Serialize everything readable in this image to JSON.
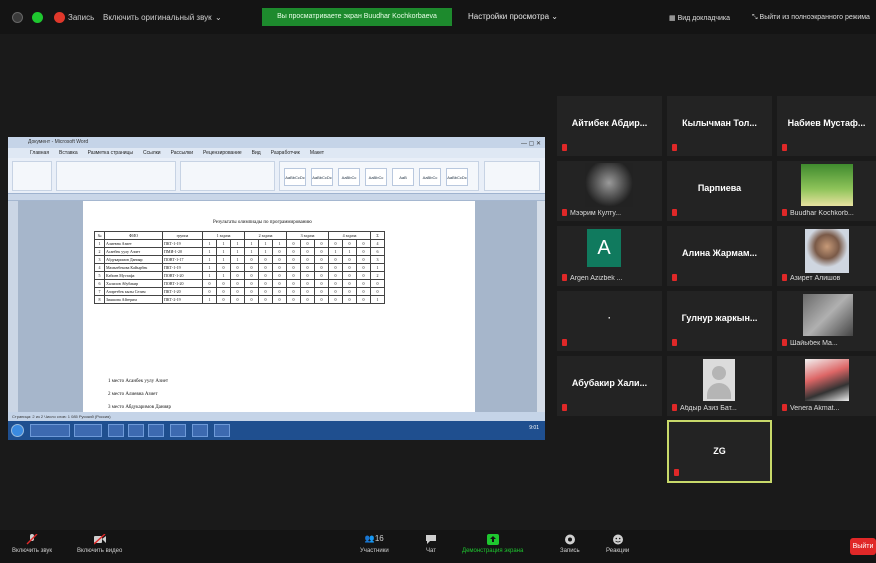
{
  "topbar": {
    "recording_label": "Запись",
    "original_sound": "Включить оригинальный звук",
    "share_banner": "Вы просматриваете экран Buudhar Kochkorbaeva",
    "view_options": "Настройки просмотра ⌄",
    "speaker_view": "Вид докладчика",
    "exit_fullscreen": "Выйти из полноэкранного режима"
  },
  "shared": {
    "window_title": "Документ - Microsoft Word",
    "ribbon_tabs": [
      "Главная",
      "Вставка",
      "Разметка страницы",
      "Ссылки",
      "Рассылки",
      "Рецензирование",
      "Вид",
      "Разработчик",
      "Макет"
    ],
    "styles": [
      "AaBbCcDc",
      "AaBbCcDc",
      "AaBbCc",
      "AaBbCc",
      "AaB",
      "AaBbCc",
      "AaBbCcDc"
    ],
    "status_text": "Страница: 2 из 2   Число слов: 1 085   Русский (Россия)",
    "clock": "9:01",
    "doc_title": "Результаты олимпиады по программированию",
    "headers": [
      "№",
      "ФИО",
      "группа",
      "1 задача",
      "2 задача",
      "3 задача",
      "4 задача",
      "Σ"
    ],
    "rows": [
      {
        "n": "1",
        "name": "Алиевна Азиет",
        "group": "ПКТ-1-19",
        "scores": [
          "1",
          "1",
          "1",
          "1",
          "1",
          "1",
          "0",
          "0",
          "0",
          "0",
          "0",
          "0",
          "4"
        ]
      },
      {
        "n": "2",
        "name": "Асанбек уулу Азиет",
        "group": "ПМИ-1-20",
        "scores": [
          "1",
          "1",
          "1",
          "1",
          "1",
          "0",
          "0",
          "0",
          "0",
          "1",
          "1",
          "0",
          "6"
        ]
      },
      {
        "n": "3",
        "name": "Абдукаримов Данияр",
        "group": "ПОВТ-1-17",
        "scores": [
          "1",
          "1",
          "1",
          "0",
          "0",
          "0",
          "0",
          "0",
          "0",
          "0",
          "0",
          "0",
          "3"
        ]
      },
      {
        "n": "4",
        "name": "Мамытбекова Кайырбек",
        "group": "ПКТ-1-19",
        "scores": [
          "1",
          "0",
          "0",
          "0",
          "0",
          "0",
          "0",
          "0",
          "0",
          "0",
          "0",
          "0",
          "1"
        ]
      },
      {
        "n": "5",
        "name": "Кабиев Мустафа",
        "group": "ПОВТ-1-20",
        "scores": [
          "1",
          "1",
          "0",
          "0",
          "0",
          "0",
          "0",
          "0",
          "0",
          "0",
          "0",
          "0",
          "2"
        ]
      },
      {
        "n": "6",
        "name": "Халилов Абубакир",
        "group": "ПОВТ-1-20",
        "scores": [
          "0",
          "0",
          "0",
          "0",
          "0",
          "0",
          "0",
          "0",
          "0",
          "0",
          "0",
          "0",
          "0"
        ]
      },
      {
        "n": "7",
        "name": "Азиретбек кызы Сезим",
        "group": "ПКТ-1-20",
        "scores": [
          "0",
          "0",
          "0",
          "0",
          "0",
          "0",
          "0",
          "0",
          "0",
          "0",
          "0",
          "0",
          "0"
        ]
      },
      {
        "n": "8",
        "name": "Зияшова Айгерим",
        "group": "ПКТ-2-19",
        "scores": [
          "1",
          "0",
          "0",
          "0",
          "0",
          "0",
          "0",
          "0",
          "0",
          "0",
          "0",
          "0",
          "1"
        ]
      }
    ],
    "list": [
      "1 место Асанбек уулу Азиет",
      "2 место Алиевна Азиет",
      "3 место Абдукаримов Данияр"
    ]
  },
  "participants": [
    {
      "name": "Айтибек Абдир...",
      "label": ""
    },
    {
      "name": "Кылычман Тол...",
      "label": ""
    },
    {
      "name": "Набиев Мустаф...",
      "label": ""
    },
    {
      "name": "",
      "label": "Мээрим Култу..."
    },
    {
      "name": "Парпиева",
      "label": ""
    },
    {
      "name": "",
      "label": "Buudhar Kochkorb..."
    },
    {
      "name": "",
      "label": "Argen Azizbek ..."
    },
    {
      "name": "Алина Жармам...",
      "label": ""
    },
    {
      "name": "",
      "label": "Азирет Алишов"
    },
    {
      "name": "·",
      "label": ""
    },
    {
      "name": "Гулнур жаркын...",
      "label": ""
    },
    {
      "name": "",
      "label": "Шайыбек Ма..."
    },
    {
      "name": "Абубакир Хали...",
      "label": ""
    },
    {
      "name": "",
      "label": "Абдыр Азиз Бат..."
    },
    {
      "name": "",
      "label": "Venera Akmat..."
    },
    {
      "name": "ZG",
      "label": ""
    }
  ],
  "avatar_letter": "A",
  "bottombar": {
    "unmute": "Включить звук",
    "start_video": "Включить видео",
    "participants": "Участники",
    "participants_count": "16",
    "chat": "Чат",
    "share": "Демонстрация экрана",
    "record": "Запись",
    "reactions": "Реакции",
    "end": "Выйти"
  },
  "colors": {
    "accent_green": "#1ec72f",
    "mute_red": "#e02828",
    "active_border": "#c8d96a"
  }
}
